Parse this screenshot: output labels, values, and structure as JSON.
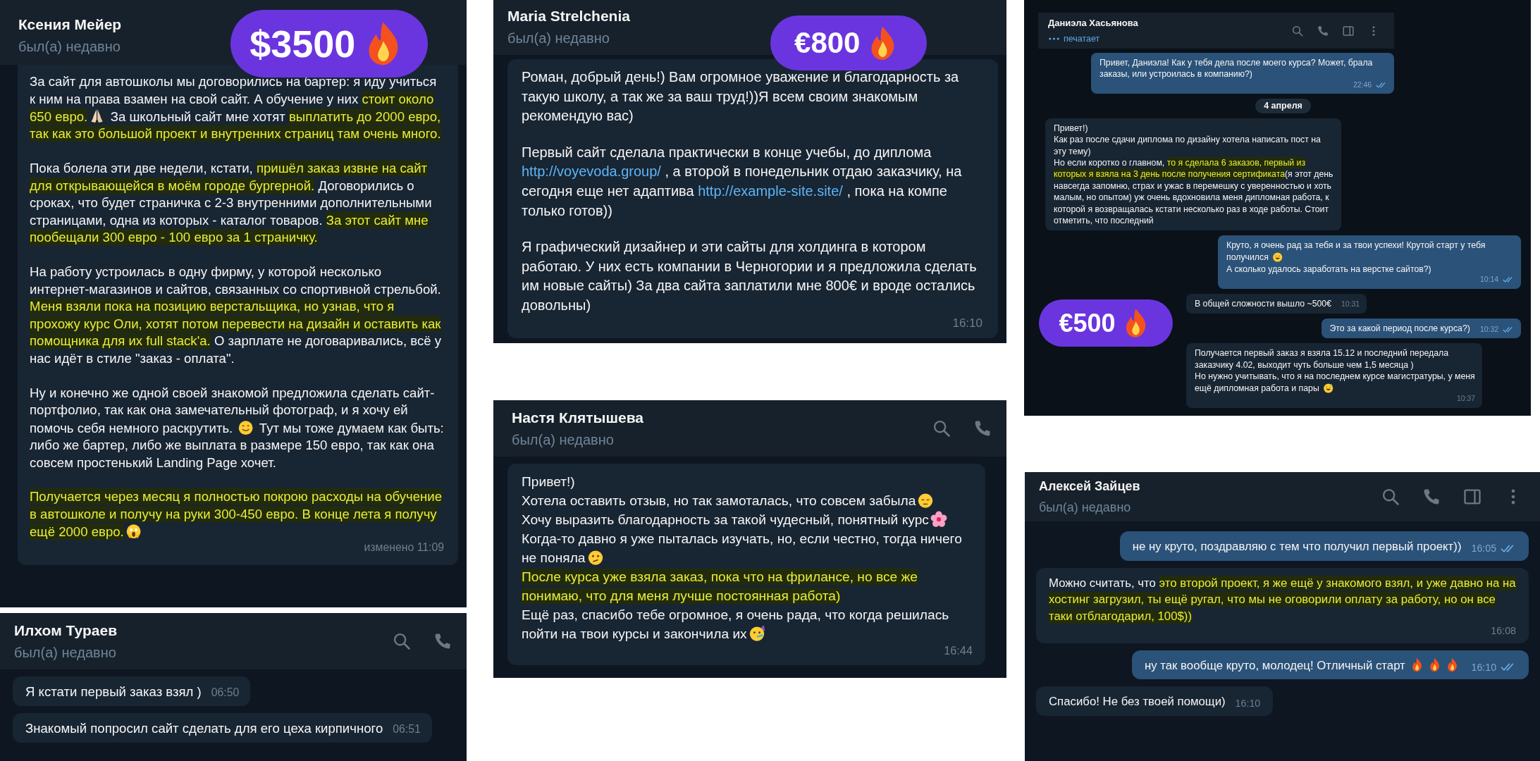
{
  "chats": [
    {
      "header": {
        "name": "Ксения Мейер",
        "status": "был(а) недавно",
        "typing": false
      },
      "badge": {
        "text": "$3500"
      },
      "messages": [
        {
          "kind": "in",
          "blocks": [
            [
              [
                {
                  "kind": "plain",
                  "text": "За сайт для автошколы мы договорились на бартер: я иду учиться к ним на права взамен на свой сайт. А обучение у них "
                },
                {
                  "kind": "hl",
                  "text": "стоит около 650 евро."
                },
                {
                  "kind": "pray"
                },
                {
                  "kind": "plain",
                  "text": " За школьный сайт мне хотят "
                },
                {
                  "kind": "hl",
                  "text": "выплатить до 2000 евро, так как это большой проект и внутренних страниц там очень много."
                }
              ]
            ],
            [
              [
                {
                  "kind": "plain",
                  "text": "Пока болела эти две недели, кстати, "
                },
                {
                  "kind": "hl",
                  "text": "пришёл заказ извне на сайт для открывающейся в моём городе бургерной."
                },
                {
                  "kind": "plain",
                  "text": " Договорились о сроках, что будет страничка с 2-3 внутренними дополнительными страницами, одна из которых - каталог товаров. "
                },
                {
                  "kind": "hl",
                  "text": "За этот сайт мне пообещали 300 евро - 100 евро за 1 страничку."
                }
              ]
            ],
            [
              [
                {
                  "kind": "plain",
                  "text": "На работу устроилась в одну фирму, у которой несколько интернет-магазинов и сайтов, связанных со спортивной стрельбой. "
                },
                {
                  "kind": "hl",
                  "text": "Меня взяли пока на позицию верстальщика, но узнав, что я прохожу курс Оли, хотят потом перевести на дизайн и оставить как помощника для их full stack'a."
                },
                {
                  "kind": "plain",
                  "text": " О зарплате не договаривались, всё у нас идёт в стиле \"заказ - оплата\"."
                }
              ]
            ],
            [
              [
                {
                  "kind": "plain",
                  "text": "Ну и конечно же одной своей знакомой предложила сделать сайт-портфолио, так как она замечательный фотограф, и я хочу ей помочь себя немного раскрутить. "
                },
                {
                  "kind": "smile"
                },
                {
                  "kind": "plain",
                  "text": " Тут мы тоже думаем как быть: либо же бартер, либо же выплата в размере 150 евро, так как она совсем простенький Landing Page хочет."
                }
              ]
            ],
            [
              [
                {
                  "kind": "hl",
                  "text": "Получается через месяц я полностью покрою расходы на обучение в автошколе и получу на руки 300-450 евро. В конце лета я получу ещё 2000 евро."
                },
                {
                  "kind": "scream"
                }
              ]
            ]
          ],
          "time": "изменено 11:09"
        }
      ]
    },
    {
      "header": {
        "name": "Илхом Тураев",
        "status": "был(а) недавно",
        "typing": false,
        "icons": [
          {
            "kind": "search"
          },
          {
            "kind": "phone"
          }
        ]
      },
      "messages": [
        {
          "kind": "in",
          "blocks": [
            [
              [
                {
                  "kind": "plain",
                  "text": "Я кстати первый заказ взял )"
                }
              ]
            ]
          ],
          "time": "06:50"
        },
        {
          "kind": "in",
          "blocks": [
            [
              [
                {
                  "kind": "plain",
                  "text": "Знакомый попросил сайт сделать для его цеха кирпичного"
                }
              ]
            ]
          ],
          "time": "06:51"
        }
      ]
    },
    {
      "header": {
        "name": "Maria Strelchenia",
        "status": "был(а) недавно",
        "typing": false
      },
      "badge": {
        "text": "€800"
      },
      "messages": [
        {
          "kind": "in",
          "blocks": [
            [
              [
                {
                  "kind": "plain",
                  "text": "Роман, добрый день!) Вам огромное уважение и благодарность за такую школу, а так же за ваш труд!))Я всем своим знакомым рекомендую вас)"
                }
              ]
            ],
            [
              [
                {
                  "kind": "plain",
                  "text": "Первый сайт сделала практически в конце учебы, до диплома "
                },
                {
                  "kind": "link",
                  "text": "http://voyevoda.group/"
                },
                {
                  "kind": "plain",
                  "text": " , а второй в понедельник отдаю заказчику, на сегодня еще нет адаптива "
                },
                {
                  "kind": "link",
                  "text": "http://example-site.site/"
                },
                {
                  "kind": "plain",
                  "text": " , пока на компе только готов))"
                }
              ]
            ],
            [
              [
                {
                  "kind": "plain",
                  "text": "Я графический дизайнер и эти сайты для холдинга в котором работаю. У них есть компании в Черногории и я предложила сделать им новые сайты) За два сайта заплатили мне 800€ и вроде остались довольны)"
                }
              ]
            ]
          ],
          "time": "16:10"
        }
      ]
    },
    {
      "header": {
        "name": "Настя Клятышева",
        "status": "был(а) недавно",
        "typing": false,
        "icons": [
          {
            "kind": "search"
          },
          {
            "kind": "phone"
          }
        ]
      },
      "messages": [
        {
          "kind": "in",
          "blocks": [
            [
              [
                {
                  "kind": "plain",
                  "text": "Привет!)"
                }
              ],
              [
                {
                  "kind": "plain",
                  "text": "Хотела оставить отзыв, но так замоталась, что совсем забыла"
                },
                {
                  "kind": "pensive"
                }
              ],
              [
                {
                  "kind": "plain",
                  "text": "Хочу выразить благодарность за такой чудесный, понятный курс"
                },
                {
                  "kind": "blossom"
                }
              ],
              [
                {
                  "kind": "plain",
                  "text": "Когда-то давно я уже пыталась изучать, но, если честно, тогда ничего не поняла"
                },
                {
                  "kind": "confused"
                }
              ],
              [
                {
                  "kind": "hl",
                  "text": "После курса уже взяла заказ, пока что на фрилансе, но все же понимаю, что для меня лучше постоянная работа)"
                }
              ],
              [
                {
                  "kind": "plain",
                  "text": "Ещё раз, спасибо тебе огромное, я очень рада, что когда решилась пойти на твои курсы и закончила их"
                },
                {
                  "kind": "party"
                }
              ]
            ]
          ],
          "time": "16:44"
        }
      ]
    },
    {
      "header": {
        "name": "Даниэла Хасьянова",
        "status": "печатает",
        "typing": true,
        "icons": [
          {
            "kind": "search"
          },
          {
            "kind": "phone"
          },
          {
            "kind": "sidebar"
          },
          {
            "kind": "more"
          }
        ]
      },
      "badge": {
        "text": "€500"
      },
      "messages": [
        {
          "kind": "out",
          "blocks": [
            [
              [
                {
                  "kind": "plain",
                  "text": "Привет, Даниэла! Как у тебя дела после моего курса? Может, брала заказы, или устроилась в компанию?)"
                }
              ]
            ]
          ],
          "time": "22:46",
          "read": true
        },
        {
          "kind": "date",
          "text": "4 апреля"
        },
        {
          "kind": "in",
          "blocks": [
            [
              [
                {
                  "kind": "plain",
                  "text": "Привет!)"
                }
              ],
              [
                {
                  "kind": "plain",
                  "text": "Как раз после сдачи диплома по дизайну хотела написать пост на эту тему)"
                }
              ],
              [
                {
                  "kind": "plain",
                  "text": "Но если коротко о главном, "
                },
                {
                  "kind": "hl",
                  "text": "то я сделала 6 заказов, первый из которых я взяла на 3 день после получения сертификата"
                },
                {
                  "kind": "plain",
                  "text": "(я этот день навсегда запомню, страх и ужас в перемешку с уверенностью и хоть малым, но опытом) уж очень вдохновила меня дипломная работа, к которой я возвращалась кстати несколько раз в ходе работы. Стоит отметить, что последний"
                }
              ]
            ]
          ]
        },
        {
          "kind": "out",
          "blocks": [
            [
              [
                {
                  "kind": "plain",
                  "text": "Круто, я очень рад за тебя и за твои успехи! Крутой старт у тебя получился "
                },
                {
                  "kind": "grin"
                }
              ],
              [
                {
                  "kind": "plain",
                  "text": "А сколько удалось заработать на верстке сайтов?)"
                }
              ]
            ]
          ],
          "time": "10:14",
          "read": true
        },
        {
          "kind": "in",
          "blocks": [
            [
              [
                {
                  "kind": "plain",
                  "text": "В общей сложности вышло ~500€"
                }
              ]
            ]
          ],
          "time": "10:31"
        },
        {
          "kind": "out",
          "blocks": [
            [
              [
                {
                  "kind": "plain",
                  "text": "Это за какой период после курса?)"
                }
              ]
            ]
          ],
          "time": "10:32",
          "read": true
        },
        {
          "kind": "in",
          "blocks": [
            [
              [
                {
                  "kind": "plain",
                  "text": "Получается первый заказ я взяла 15.12 и последний передала заказчику 4.02, выходит чуть больше чем 1,5 месяца )"
                }
              ],
              [
                {
                  "kind": "plain",
                  "text": "Но нужно учитывать, что я на последнем курсе магистратуры, у меня ещё дипломная работа и пары "
                },
                {
                  "kind": "sweat"
                }
              ]
            ]
          ],
          "time": "10:37"
        }
      ]
    },
    {
      "header": {
        "name": "Алексей Зайцев",
        "status": "был(а) недавно",
        "typing": false,
        "icons": [
          {
            "kind": "search"
          },
          {
            "kind": "phone"
          },
          {
            "kind": "sidebar"
          },
          {
            "kind": "more"
          }
        ]
      },
      "messages": [
        {
          "kind": "out",
          "blocks": [
            [
              [
                {
                  "kind": "plain",
                  "text": "не ну круто, поздравляю с тем что получил первый проект))"
                }
              ]
            ]
          ],
          "time": "16:05",
          "read": true
        },
        {
          "kind": "in",
          "blocks": [
            [
              [
                {
                  "kind": "plain",
                  "text": "Можно считать, что "
                },
                {
                  "kind": "hl",
                  "text": "это второй проект, я же ещё у знакомого взял, и уже давно на на хостинг загрузил, ты ещё ругал, что мы не оговорили оплату за работу, но он все таки отблагодарил, 100$))"
                }
              ]
            ]
          ],
          "time": "16:08"
        },
        {
          "kind": "out",
          "blocks": [
            [
              [
                {
                  "kind": "plain",
                  "text": "ну так вообще круто, молодец! Отличный старт "
                },
                {
                  "kind": "fire"
                },
                {
                  "kind": "fire"
                },
                {
                  "kind": "fire"
                }
              ]
            ]
          ],
          "time": "16:10",
          "read": true
        },
        {
          "kind": "in",
          "blocks": [
            [
              [
                {
                  "kind": "plain",
                  "text": "Спасибо! Не без твоей помощи)"
                }
              ]
            ]
          ],
          "time": "16:10"
        }
      ]
    }
  ]
}
